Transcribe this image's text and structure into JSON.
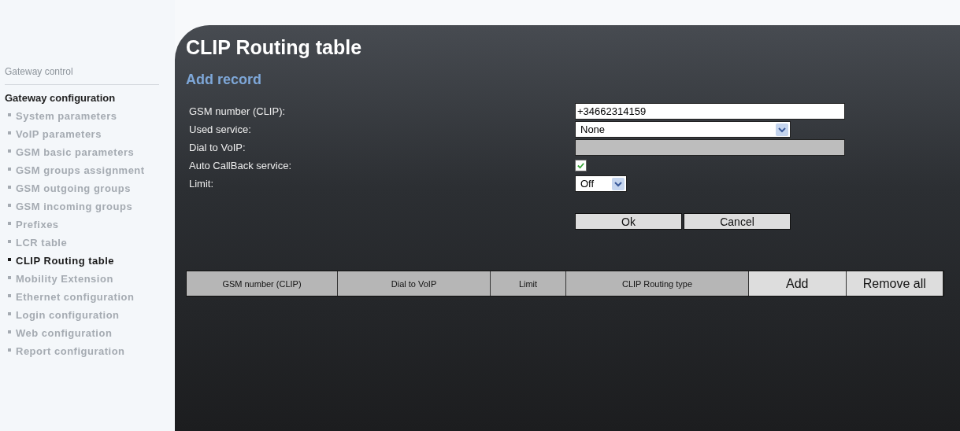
{
  "sidebar": {
    "control_link": "Gateway control",
    "section_title": "Gateway configuration",
    "items": [
      {
        "label": "System parameters",
        "selected": false
      },
      {
        "label": "VoIP parameters",
        "selected": false
      },
      {
        "label": "GSM basic parameters",
        "selected": false
      },
      {
        "label": "GSM groups assignment",
        "selected": false
      },
      {
        "label": "GSM outgoing groups",
        "selected": false
      },
      {
        "label": "GSM incoming groups",
        "selected": false
      },
      {
        "label": "Prefixes",
        "selected": false
      },
      {
        "label": "LCR table",
        "selected": false
      },
      {
        "label": "CLIP Routing table",
        "selected": true
      },
      {
        "label": "Mobility Extension",
        "selected": false
      },
      {
        "label": "Ethernet configuration",
        "selected": false
      },
      {
        "label": "Login configuration",
        "selected": false
      },
      {
        "label": "Web configuration",
        "selected": false
      },
      {
        "label": "Report configuration",
        "selected": false
      }
    ]
  },
  "page_title": "CLIP Routing table",
  "form": {
    "title": "Add record",
    "fields": [
      {
        "kind": "text",
        "label": "GSM number (CLIP):",
        "value": "+34662314159",
        "disabled": false
      },
      {
        "kind": "select",
        "label": "Used service:",
        "value": "None"
      },
      {
        "kind": "text",
        "label": "Dial to VoIP:",
        "disabled": true
      },
      {
        "kind": "checkbox",
        "label": "Auto CallBack service:",
        "checked": true
      },
      {
        "kind": "small_select",
        "label": "Limit:",
        "value": "Off"
      }
    ],
    "buttons": [
      "Ok",
      "Cancel"
    ]
  },
  "table": {
    "columns": [
      "GSM number (CLIP)",
      "Dial to VoIP",
      "Limit",
      "CLIP Routing type"
    ],
    "buttons": [
      "Add",
      "Remove all"
    ]
  }
}
